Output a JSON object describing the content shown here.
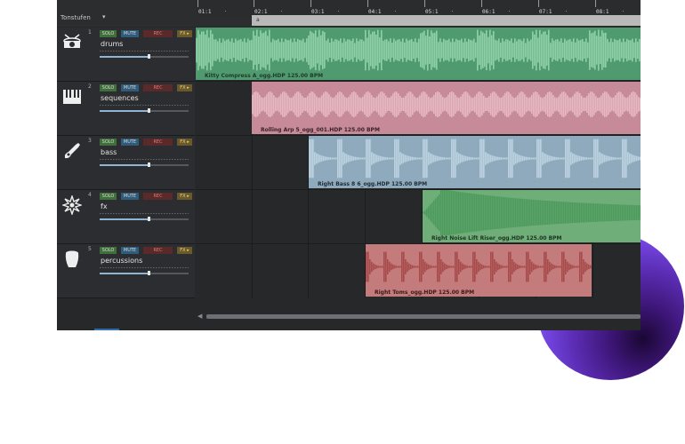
{
  "header": {
    "left_label": "Tonstufen",
    "loop_marker": "a"
  },
  "ruler": {
    "bars": [
      "01:1",
      "02:1",
      "03:1",
      "04:1",
      "05:1",
      "06:1",
      "07:1",
      "08:1"
    ]
  },
  "buttons": {
    "solo": "SOLO",
    "mute": "MUTE",
    "rec": "REC",
    "fx": "FX ▸"
  },
  "tracks": [
    {
      "number": "1",
      "name": "drums",
      "icon": "drum-icon",
      "volume": 0.55
    },
    {
      "number": "2",
      "name": "sequences",
      "icon": "keyboard-icon",
      "volume": 0.55
    },
    {
      "number": "3",
      "name": "bass",
      "icon": "guitar-icon",
      "volume": 0.55
    },
    {
      "number": "4",
      "name": "fx",
      "icon": "explosion-icon",
      "volume": 0.55
    },
    {
      "number": "5",
      "name": "percussions",
      "icon": "conga-icon",
      "volume": 0.55
    }
  ],
  "clips": [
    {
      "label": "Kitty Compress A_ogg.HDP  125.00 BPM",
      "color": "#4f9a6e",
      "wave": "#8fd0a8",
      "label_color": "#1f3a2a"
    },
    {
      "label": "Rolling Arp 5_ogg_001.HDP  125.00 BPM",
      "color": "#c68a98",
      "wave": "#e6b8c2",
      "label_color": "#3a1f26"
    },
    {
      "label": "Right Bass 8 6_ogg.HDP  125.00 BPM",
      "color": "#8eaabc",
      "wave": "#bcd2e0",
      "label_color": "#1f2a33"
    },
    {
      "label": "Right Noise Lift Riser_ogg.HDP  125.00 BPM",
      "color": "#6fae78",
      "wave": "#4c9a5c",
      "label_color": "#1e3322"
    },
    {
      "label": "Right Toms_ogg.HDP  125.00 BPM",
      "color": "#c47b7b",
      "wave": "#a84a4a",
      "label_color": "#3a1a1a"
    }
  ]
}
